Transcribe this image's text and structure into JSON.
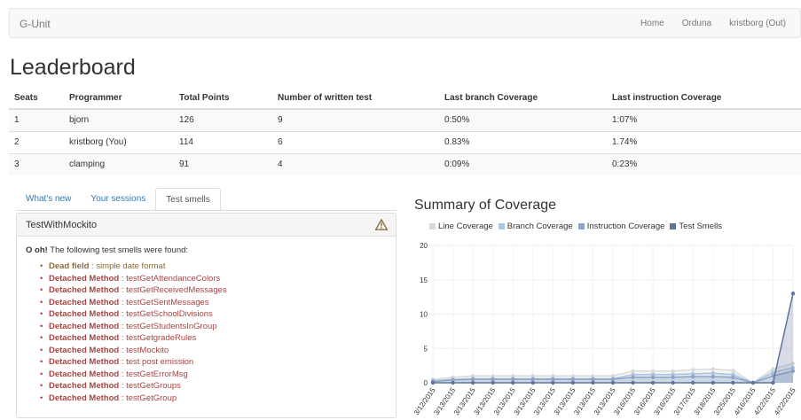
{
  "navbar": {
    "brand": "G-Unit",
    "links": [
      "Home",
      "Orduna",
      "kristborg (Out)"
    ]
  },
  "page_title": "Leaderboard",
  "table": {
    "headers": [
      "Seats",
      "Programmer",
      "Total Points",
      "Number of written test",
      "Last branch Coverage",
      "Last instruction Coverage"
    ],
    "rows": [
      [
        "1",
        "bjorn",
        "126",
        "9",
        "0:50%",
        "1:07%"
      ],
      [
        "2",
        "kristborg (You)",
        "114",
        "6",
        "0.83%",
        "1.74%"
      ],
      [
        "3",
        "clamping",
        "91",
        "4",
        "0:09%",
        "0:23%"
      ]
    ]
  },
  "tabs": [
    "What's new",
    "Your sessions",
    "Test smells"
  ],
  "active_tab": "Test smells",
  "panel": {
    "title": "TestWithMockito",
    "icon": "warning-icon",
    "intro_bold": "O oh!",
    "intro_rest": " The following test smells were found:",
    "smells": [
      {
        "name": "Dead field",
        "detail": " : simple date format"
      },
      {
        "name": "Detached Method",
        "detail": " : testGetAttendanceColors"
      },
      {
        "name": "Detached Method",
        "detail": " : testGetReceivedMessages"
      },
      {
        "name": "Detached Method",
        "detail": " : testGetSentMessages"
      },
      {
        "name": "Detached Method",
        "detail": " : testGetSchoolDivisions"
      },
      {
        "name": "Detached Method",
        "detail": " : testGetStudentsInGroup"
      },
      {
        "name": "Detached Method",
        "detail": " : testGetgradeRules"
      },
      {
        "name": "Detached Method",
        "detail": " : testMockito"
      },
      {
        "name": "Detached Method",
        "detail": " : test post emission"
      },
      {
        "name": "Detached Method",
        "detail": " : testGetErrorMsg"
      },
      {
        "name": "Detached Method",
        "detail": " : testGetGroups"
      },
      {
        "name": "Detached Method",
        "detail": " : testGetGroup"
      }
    ]
  },
  "colors": {
    "link": "#337ab7",
    "danger": "#a94442",
    "warning": "#8a6d3b"
  },
  "chart_data": {
    "type": "area",
    "title": "Summary of Coverage",
    "categories": [
      "3/12/2015",
      "3/13/2015",
      "3/13/2015",
      "3/13/2015",
      "3/13/2015",
      "3/13/2015",
      "3/13/2015",
      "3/13/2015",
      "3/13/2015",
      "3/13/2015",
      "3/16/2015",
      "3/16/2015",
      "3/16/2015",
      "3/17/2015",
      "3/18/2015",
      "3/25/2015",
      "4/16/2015",
      "4/22/2015",
      "4/22/2015"
    ],
    "ylim": [
      0,
      20
    ],
    "yticks": [
      0,
      5,
      10,
      15,
      20
    ],
    "grid": true,
    "legend_position": "top",
    "series": [
      {
        "name": "Line Coverage",
        "color": "#d9d9d9",
        "values": [
          0.5,
          0.8,
          1.0,
          1.0,
          1.0,
          1.0,
          1.0,
          1.0,
          1.0,
          1.0,
          1.7,
          1.7,
          1.7,
          1.9,
          2.0,
          1.8,
          0,
          2.0,
          2.8
        ]
      },
      {
        "name": "Branch Coverage",
        "color": "#a9c4dc",
        "values": [
          0.3,
          0.5,
          0.6,
          0.6,
          0.6,
          0.6,
          0.6,
          0.6,
          0.6,
          0.6,
          1.2,
          1.2,
          1.2,
          1.3,
          1.4,
          1.2,
          0,
          1.5,
          2.2
        ]
      },
      {
        "name": "Instruction Coverage",
        "color": "#8fa3c8",
        "values": [
          0.2,
          0.4,
          0.5,
          0.5,
          0.5,
          0.5,
          0.5,
          0.5,
          0.5,
          0.5,
          0.8,
          0.8,
          0.8,
          0.9,
          0.9,
          0.8,
          0,
          1.0,
          1.7
        ]
      },
      {
        "name": "Test Smells",
        "color": "#5f739f",
        "values": [
          0,
          0,
          0,
          0,
          0,
          0,
          0,
          0,
          0,
          0,
          0,
          0,
          0,
          0,
          0,
          0,
          0,
          0,
          13
        ]
      }
    ]
  }
}
